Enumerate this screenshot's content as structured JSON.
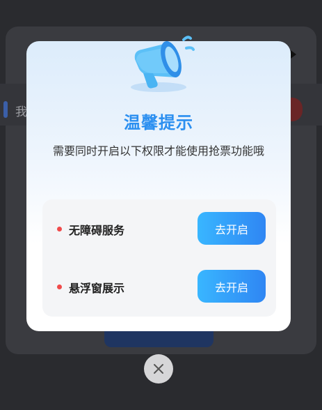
{
  "background": {
    "left_text": "我"
  },
  "dialog": {
    "title": "温馨提示",
    "message": "需要同时开启以下权限才能使用抢票功能哦",
    "permissions": [
      {
        "label": "无障碍服务",
        "button_label": "去开启"
      },
      {
        "label": "悬浮窗展示",
        "button_label": "去开启"
      }
    ]
  },
  "icons": {
    "header": "megaphone-icon",
    "close": "close-icon"
  },
  "colors": {
    "accent": "#2b8ff0",
    "button_start": "#39b6ff",
    "button_end": "#2f86f3",
    "bullet": "#f04a4a"
  }
}
